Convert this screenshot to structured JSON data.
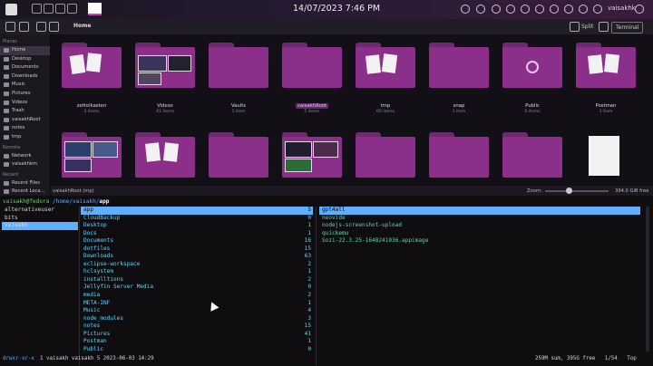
{
  "panel": {
    "clock": "14/07/2023  7:46 PM",
    "user": "vaisakhk"
  },
  "dolphin": {
    "breadcrumb": "Home",
    "split_label": "Split",
    "terminal_label": "Terminal",
    "places": {
      "places_header": "Places",
      "items": [
        "Home",
        "Desktop",
        "Documents",
        "Downloads",
        "Music",
        "Pictures",
        "Videos",
        "Trash",
        "vaisakhRoot",
        "notes",
        "tmp"
      ],
      "remote_header": "Remote",
      "remote_items": [
        "Network",
        "vaisakhkm"
      ],
      "recent_header": "Recent",
      "recent_items": [
        "Recent Files",
        "Recent Loca..."
      ]
    },
    "folders_row1": [
      {
        "name": "zettelkasten",
        "sub": "3 items"
      },
      {
        "name": "Videos",
        "sub": "41 items"
      },
      {
        "name": "Vaults",
        "sub": "1 item"
      },
      {
        "name": "vaisakhRoot",
        "sub": "5 items"
      },
      {
        "name": "tmp",
        "sub": "60 items"
      },
      {
        "name": "snap",
        "sub": "1 item"
      },
      {
        "name": "Public",
        "sub": "0 items"
      },
      {
        "name": "Postman",
        "sub": "1 item"
      }
    ],
    "status_left": "vaisakhRoot (mp)",
    "zoom_label": "Zoom:",
    "free_space": "394.0 GiB free"
  },
  "terminal": {
    "prompt_user": "vaisakh@fedora",
    "prompt_path": "/home/vaisakh/",
    "prompt_dir": "app",
    "parent_items": [
      "alternativeuser",
      "bits",
      "vaisakh"
    ],
    "main_items": [
      {
        "name": "app",
        "count": "5"
      },
      {
        "name": "CloudBackup",
        "count": "0"
      },
      {
        "name": "Desktop",
        "count": "1"
      },
      {
        "name": "Docs",
        "count": "1"
      },
      {
        "name": "Documents",
        "count": "16"
      },
      {
        "name": "dotfiles",
        "count": "15"
      },
      {
        "name": "Downloads",
        "count": "63"
      },
      {
        "name": "eclipse-workspace",
        "count": "2"
      },
      {
        "name": "hclsystem",
        "count": "1"
      },
      {
        "name": "installtions",
        "count": "2"
      },
      {
        "name": "Jellyfin Server Media",
        "count": "0"
      },
      {
        "name": "media",
        "count": "2"
      },
      {
        "name": "META-INF",
        "count": "1"
      },
      {
        "name": "Music",
        "count": "4"
      },
      {
        "name": "node_modules",
        "count": "3"
      },
      {
        "name": "notes",
        "count": "15"
      },
      {
        "name": "Pictures",
        "count": "41"
      },
      {
        "name": "Postman",
        "count": "1"
      },
      {
        "name": "Public",
        "count": "0"
      }
    ],
    "preview_items": [
      "gpt4all",
      "neovide",
      "nodejs-screenshot-upload",
      "quickemu",
      "Sozi-22.3.25-1648241936.appimage"
    ],
    "perm": "drwxr-xr-x",
    "info": "1 vaisakh vaisakh 5 2023-06-03 14:29",
    "right_status": "259M sum, 395G free   1/54   Top"
  }
}
